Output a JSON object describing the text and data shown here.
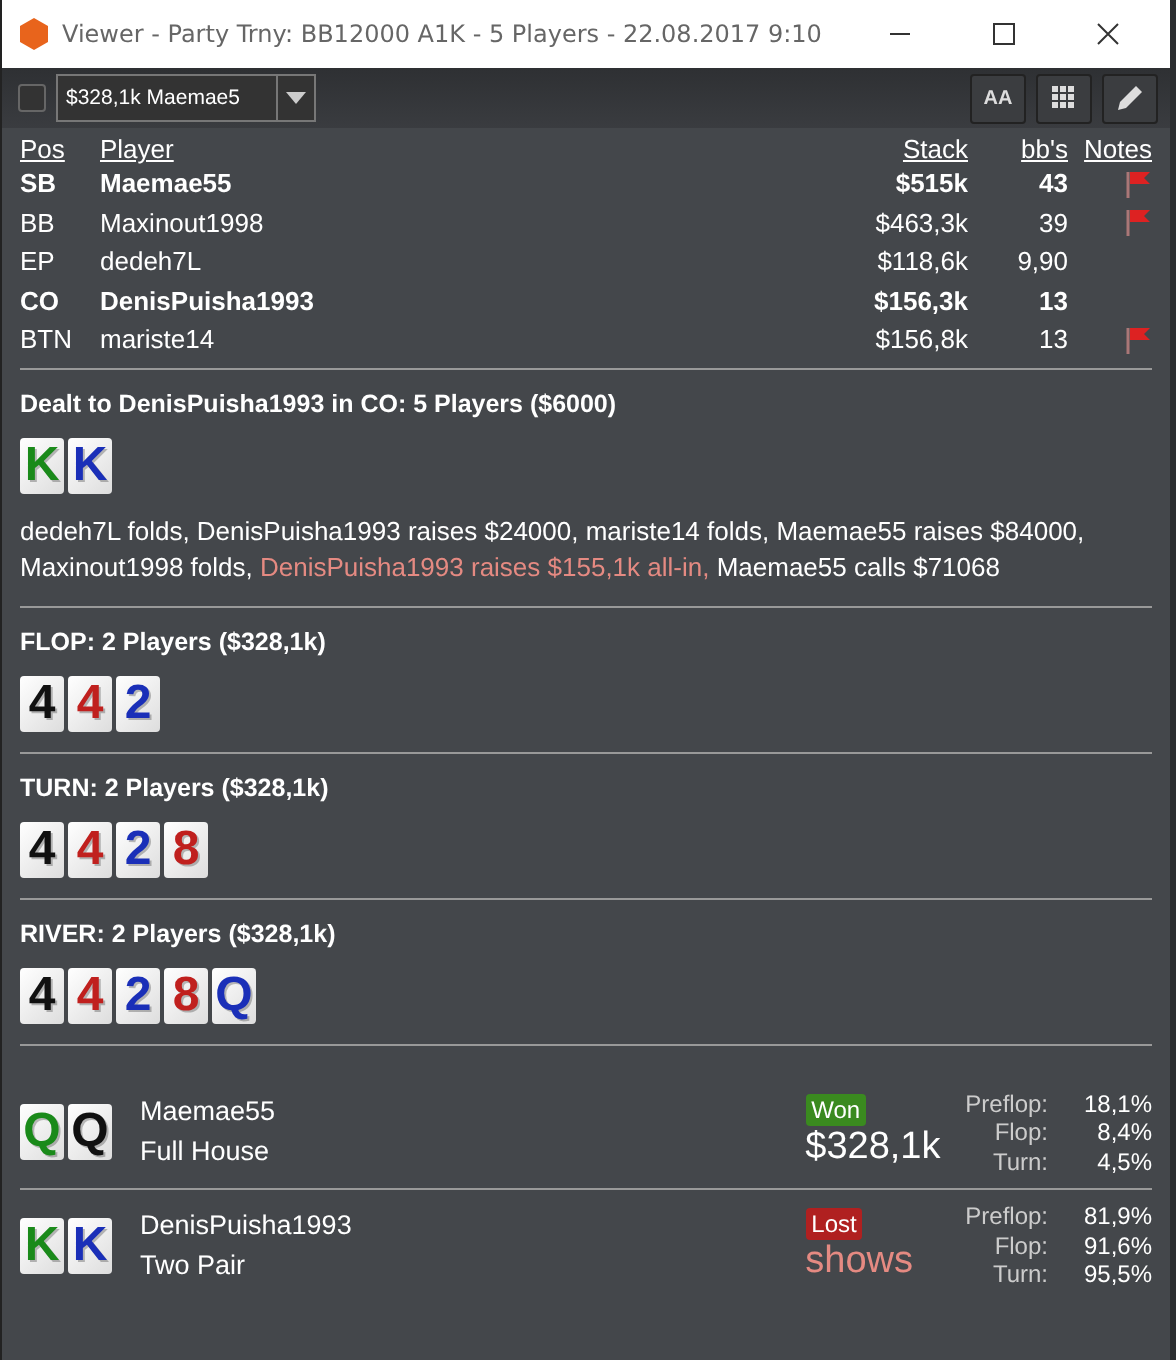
{
  "window": {
    "title": "Viewer - Party Trny: BB12000 A1K - 5 Players - 22.08.2017 9:10"
  },
  "toolbar": {
    "checked": false,
    "hand_select": "$328,1k Maemae5",
    "font_button": "AA"
  },
  "players": {
    "columns": [
      "Pos",
      "Player",
      "Stack",
      "bb's",
      "Notes"
    ],
    "rows": [
      {
        "pos": "SB",
        "name": "Maemae55",
        "stack": "$515k",
        "bbs": "43",
        "bold": true,
        "note": true
      },
      {
        "pos": "BB",
        "name": "Maxinout1998",
        "stack": "$463,3k",
        "bbs": "39",
        "bold": false,
        "note": true
      },
      {
        "pos": "EP",
        "name": "dedeh7L",
        "stack": "$118,6k",
        "bbs": "9,90",
        "bold": false,
        "note": false
      },
      {
        "pos": "CO",
        "name": "DenisPuisha1993",
        "stack": "$156,3k",
        "bbs": "13",
        "bold": true,
        "note": false
      },
      {
        "pos": "BTN",
        "name": "mariste14",
        "stack": "$156,8k",
        "bbs": "13",
        "bold": false,
        "note": true
      }
    ]
  },
  "streets": [
    {
      "title": "Dealt to DenisPuisha1993 in CO: 5 Players ($6000)",
      "cards": [
        {
          "rank": "K",
          "color": "#1a8a1a"
        },
        {
          "rank": "K",
          "color": "#1a2fb8"
        }
      ],
      "actions": [
        {
          "text": "dedeh7L folds, DenisPuisha1993 raises $24000, mariste14 folds, Maemae55 raises $84000, Maxinout1998 folds, ",
          "highlight": false
        },
        {
          "text": "DenisPuisha1993 raises $155,1k all-in,",
          "highlight": true
        },
        {
          "text": " Maemae55 calls $71068",
          "highlight": false
        }
      ]
    },
    {
      "title": "FLOP: 2 Players ($328,1k)",
      "cards": [
        {
          "rank": "4",
          "color": "#111111"
        },
        {
          "rank": "4",
          "color": "#c0201e"
        },
        {
          "rank": "2",
          "color": "#1a2fb8"
        }
      ]
    },
    {
      "title": "TURN: 2 Players ($328,1k)",
      "cards": [
        {
          "rank": "4",
          "color": "#111111"
        },
        {
          "rank": "4",
          "color": "#c0201e"
        },
        {
          "rank": "2",
          "color": "#1a2fb8"
        },
        {
          "rank": "8",
          "color": "#c0201e"
        }
      ]
    },
    {
      "title": "RIVER: 2 Players ($328,1k)",
      "cards": [
        {
          "rank": "4",
          "color": "#111111"
        },
        {
          "rank": "4",
          "color": "#c0201e"
        },
        {
          "rank": "2",
          "color": "#1a2fb8"
        },
        {
          "rank": "8",
          "color": "#c0201e"
        },
        {
          "rank": "Q",
          "color": "#1a2fb8"
        }
      ]
    }
  ],
  "showdown": [
    {
      "cards": [
        {
          "rank": "Q",
          "color": "#1a8a1a"
        },
        {
          "rank": "Q",
          "color": "#111111"
        }
      ],
      "name": "Maemae55",
      "hand": "Full House",
      "result": "Won",
      "kind": "won",
      "amount": "$328,1k",
      "equity": [
        {
          "label": "Preflop:",
          "value": "18,1%"
        },
        {
          "label": "Flop:",
          "value": "8,4%"
        },
        {
          "label": "Turn:",
          "value": "4,5%"
        }
      ]
    },
    {
      "cards": [
        {
          "rank": "K",
          "color": "#1a8a1a"
        },
        {
          "rank": "K",
          "color": "#1a2fb8"
        }
      ],
      "name": "DenisPuisha1993",
      "hand": "Two Pair",
      "result": "Lost",
      "kind": "lost",
      "amount": "shows",
      "equity": [
        {
          "label": "Preflop:",
          "value": "81,9%"
        },
        {
          "label": "Flop:",
          "value": "91,6%"
        },
        {
          "label": "Turn:",
          "value": "95,5%"
        }
      ]
    }
  ]
}
